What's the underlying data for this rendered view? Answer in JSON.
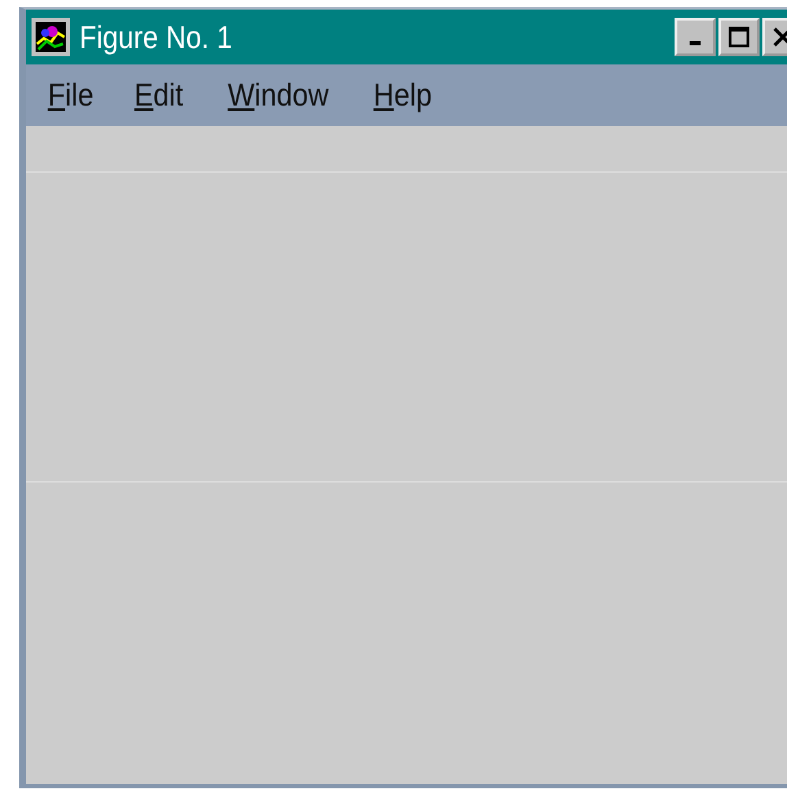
{
  "window": {
    "title": "Figure No. 1"
  },
  "menu": [
    {
      "label": "File"
    },
    {
      "label": "Edit"
    },
    {
      "label": "Window"
    },
    {
      "label": "Help"
    }
  ]
}
